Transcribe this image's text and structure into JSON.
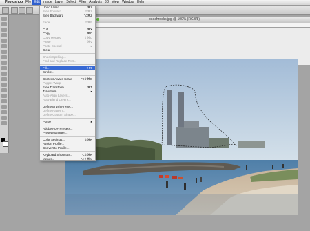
{
  "menubar": {
    "apple": "",
    "items": [
      "Photoshop",
      "File",
      "Edit",
      "Image",
      "Layer",
      "Select",
      "Filter",
      "Analysis",
      "3D",
      "View",
      "Window",
      "Help"
    ],
    "active_index": 2
  },
  "document": {
    "title": "beachrocks.jpg @ 100% (RGB/8)"
  },
  "edit_menu": {
    "items": [
      {
        "type": "item",
        "label": "Undo Lasso",
        "shortcut": "⌘Z",
        "enabled": true
      },
      {
        "type": "item",
        "label": "Step Forward",
        "shortcut": "⇧⌘Z",
        "enabled": false
      },
      {
        "type": "item",
        "label": "Step Backward",
        "shortcut": "⌥⌘Z",
        "enabled": true
      },
      {
        "type": "sep"
      },
      {
        "type": "item",
        "label": "Fade...",
        "shortcut": "⇧⌘F",
        "enabled": false
      },
      {
        "type": "sep"
      },
      {
        "type": "item",
        "label": "Cut",
        "shortcut": "⌘X",
        "enabled": true
      },
      {
        "type": "item",
        "label": "Copy",
        "shortcut": "⌘C",
        "enabled": true
      },
      {
        "type": "item",
        "label": "Copy Merged",
        "shortcut": "⇧⌘C",
        "enabled": false
      },
      {
        "type": "item",
        "label": "Paste",
        "shortcut": "⌘V",
        "enabled": false
      },
      {
        "type": "item",
        "label": "Paste Special",
        "shortcut": "▸",
        "enabled": false
      },
      {
        "type": "item",
        "label": "Clear",
        "shortcut": "",
        "enabled": true
      },
      {
        "type": "sep"
      },
      {
        "type": "item",
        "label": "Check Spelling...",
        "shortcut": "",
        "enabled": false
      },
      {
        "type": "item",
        "label": "Find and Replace Text...",
        "shortcut": "",
        "enabled": false
      },
      {
        "type": "sep"
      },
      {
        "type": "item",
        "label": "Fill...",
        "shortcut": "⇧F5",
        "enabled": true,
        "highlighted": true
      },
      {
        "type": "item",
        "label": "Stroke...",
        "shortcut": "",
        "enabled": true
      },
      {
        "type": "sep"
      },
      {
        "type": "item",
        "label": "Content-Aware Scale",
        "shortcut": "⌥⇧⌘C",
        "enabled": true
      },
      {
        "type": "item",
        "label": "Puppet Warp",
        "shortcut": "",
        "enabled": false
      },
      {
        "type": "item",
        "label": "Free Transform",
        "shortcut": "⌘T",
        "enabled": true
      },
      {
        "type": "item",
        "label": "Transform",
        "shortcut": "▸",
        "enabled": true
      },
      {
        "type": "item",
        "label": "Auto-Align Layers...",
        "shortcut": "",
        "enabled": false
      },
      {
        "type": "item",
        "label": "Auto-Blend Layers...",
        "shortcut": "",
        "enabled": false
      },
      {
        "type": "sep"
      },
      {
        "type": "item",
        "label": "Define Brush Preset...",
        "shortcut": "",
        "enabled": true
      },
      {
        "type": "item",
        "label": "Define Pattern...",
        "shortcut": "",
        "enabled": false
      },
      {
        "type": "item",
        "label": "Define Custom Shape...",
        "shortcut": "",
        "enabled": false
      },
      {
        "type": "sep"
      },
      {
        "type": "item",
        "label": "Purge",
        "shortcut": "▸",
        "enabled": true
      },
      {
        "type": "sep"
      },
      {
        "type": "item",
        "label": "Adobe PDF Presets...",
        "shortcut": "",
        "enabled": true
      },
      {
        "type": "item",
        "label": "Preset Manager...",
        "shortcut": "",
        "enabled": true
      },
      {
        "type": "sep"
      },
      {
        "type": "item",
        "label": "Color Settings...",
        "shortcut": "⇧⌘K",
        "enabled": true
      },
      {
        "type": "item",
        "label": "Assign Profile...",
        "shortcut": "",
        "enabled": true
      },
      {
        "type": "item",
        "label": "Convert to Profile...",
        "shortcut": "",
        "enabled": true
      },
      {
        "type": "sep"
      },
      {
        "type": "item",
        "label": "Keyboard Shortcuts...",
        "shortcut": "⌥⇧⌘K",
        "enabled": true
      },
      {
        "type": "item",
        "label": "Menus...",
        "shortcut": "⌥⇧⌘M",
        "enabled": true
      }
    ]
  },
  "colors": {
    "menu_highlight": "#3769d4",
    "foreground_swatch": "#000000",
    "background_swatch": "#ffffff"
  }
}
